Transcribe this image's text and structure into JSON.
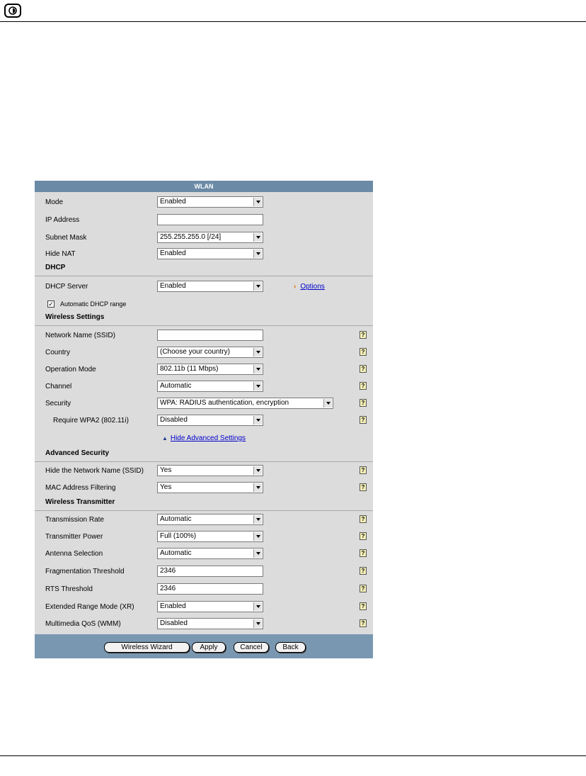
{
  "panel_title": "WLAN",
  "fields": {
    "mode": {
      "label": "Mode",
      "value": "Enabled"
    },
    "ip_address": {
      "label": "IP Address",
      "value": ""
    },
    "subnet_mask": {
      "label": "Subnet Mask",
      "value": "255.255.255.0 [/24]"
    },
    "hide_nat": {
      "label": "Hide NAT",
      "value": "Enabled"
    }
  },
  "dhcp": {
    "section_title": "DHCP",
    "server": {
      "label": "DHCP Server",
      "value": "Enabled"
    },
    "options_link": "Options",
    "auto_range": {
      "label": "Automatic DHCP range",
      "checked": true,
      "mark": "✓"
    }
  },
  "wireless": {
    "section_title": "Wireless Settings",
    "ssid": {
      "label": "Network Name (SSID)",
      "value": ""
    },
    "country": {
      "label": "Country",
      "value": "(Choose your country)"
    },
    "operation_mode": {
      "label": "Operation Mode",
      "value": "802.11b (11 Mbps)"
    },
    "channel": {
      "label": "Channel",
      "value": "Automatic"
    },
    "security": {
      "label": "Security",
      "value": "WPA: RADIUS authentication, encryption"
    },
    "require_wpa2": {
      "label": "Require WPA2 (802.11i)",
      "value": "Disabled"
    },
    "hide_advanced_link": "Hide Advanced Settings"
  },
  "advanced_security": {
    "section_title": "Advanced Security",
    "hide_ssid": {
      "label": "Hide the Network Name (SSID)",
      "value": "Yes"
    },
    "mac_filtering": {
      "label": "MAC Address Filtering",
      "value": "Yes"
    }
  },
  "transmitter": {
    "section_title": "Wireless Transmitter",
    "transmission_rate": {
      "label": "Transmission Rate",
      "value": "Automatic"
    },
    "transmitter_power": {
      "label": "Transmitter Power",
      "value": "Full (100%)"
    },
    "antenna_selection": {
      "label": "Antenna Selection",
      "value": "Automatic"
    },
    "fragmentation_threshold": {
      "label": "Fragmentation Threshold",
      "value": "2346"
    },
    "rts_threshold": {
      "label": "RTS Threshold",
      "value": "2346"
    },
    "xr_mode": {
      "label": "Extended Range Mode (XR)",
      "value": "Enabled"
    },
    "wmm": {
      "label": "Multimedia QoS (WMM)",
      "value": "Disabled"
    }
  },
  "buttons": {
    "wizard": "Wireless Wizard",
    "apply": "Apply",
    "cancel": "Cancel",
    "back": "Back"
  },
  "help_glyph": "?",
  "icons": {
    "logo": "logo-icon",
    "help": "help-icon",
    "dropdown": "chevron-down-icon"
  }
}
